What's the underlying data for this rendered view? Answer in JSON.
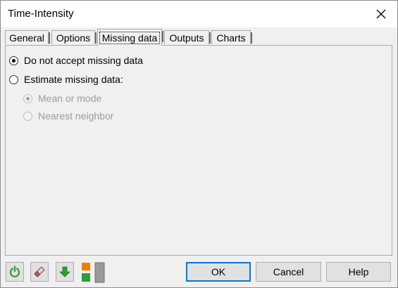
{
  "window": {
    "title": "Time-Intensity"
  },
  "tabs": [
    {
      "label": "General"
    },
    {
      "label": "Options"
    },
    {
      "label": "Missing data"
    },
    {
      "label": "Outputs"
    },
    {
      "label": "Charts"
    }
  ],
  "missing_data": {
    "do_not_accept": {
      "label": "Do not accept missing data",
      "checked": true
    },
    "estimate": {
      "label": "Estimate missing data:",
      "checked": false
    },
    "mean_or_mode": {
      "label": "Mean or mode",
      "checked": true,
      "enabled": false
    },
    "nearest_neighbor": {
      "label": "Nearest neighbor",
      "checked": false,
      "enabled": false
    }
  },
  "buttons": {
    "ok": "OK",
    "cancel": "Cancel",
    "help": "Help"
  },
  "icons": {
    "reset": "refresh-icon",
    "clear": "eraser-icon",
    "load": "down-arrow-icon",
    "toggle": "layout-toggle-icon"
  },
  "colors": {
    "green": "#2e9e3a",
    "orange": "#f07d00"
  }
}
